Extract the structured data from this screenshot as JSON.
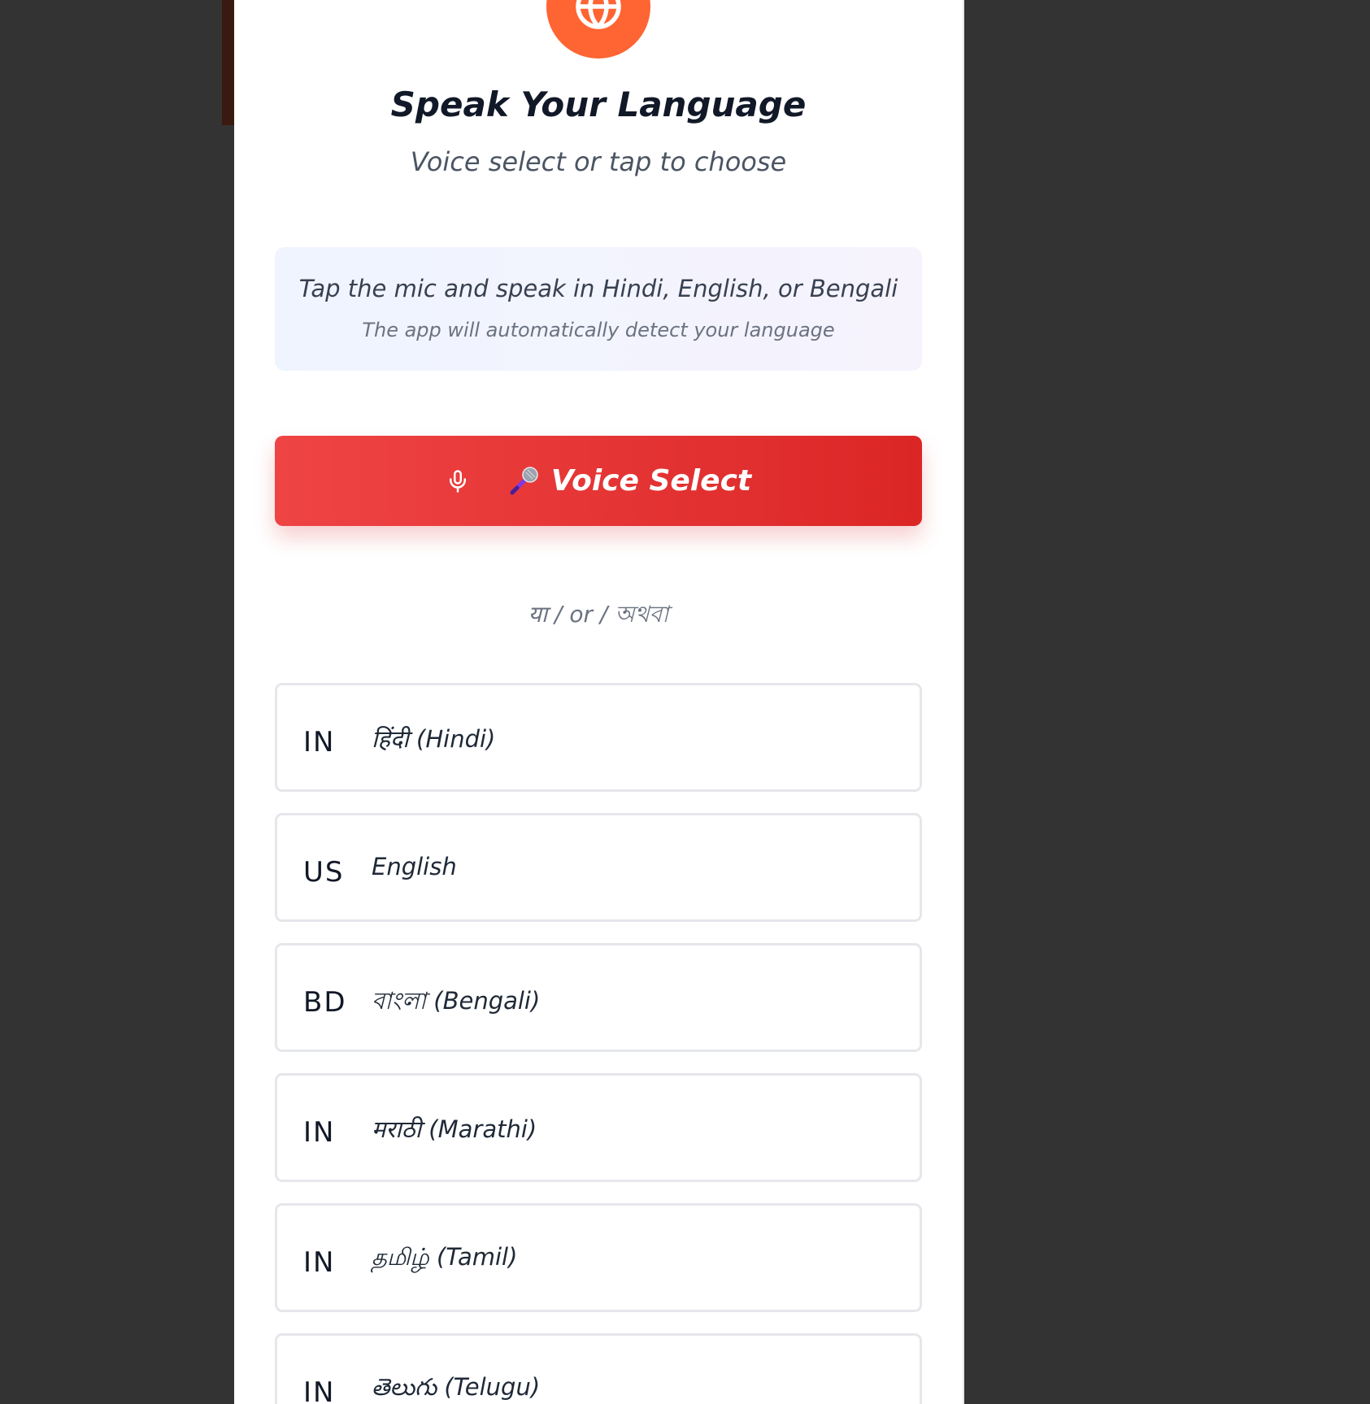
{
  "colors": {
    "accent_orange": "#ff6433",
    "voice_button_red": "#dc2626",
    "backdrop": "#333333",
    "panel": "#ffffff"
  },
  "header": {
    "icon": "globe-icon",
    "title": "Speak Your Language",
    "subtitle": "Voice select or tap to choose"
  },
  "hint": {
    "main": "Tap the mic and speak in Hindi, English, or Bengali",
    "sub": "The app will automatically detect your language"
  },
  "voice_button": {
    "icon": "microphone-icon",
    "emoji": "🎤",
    "label": "Voice Select"
  },
  "divider": {
    "text": "या / or / অথবা"
  },
  "languages": [
    {
      "code": "IN",
      "name": "हिंदी (Hindi)"
    },
    {
      "code": "US",
      "name": "English"
    },
    {
      "code": "BD",
      "name": "বাংলা (Bengali)"
    },
    {
      "code": "IN",
      "name": "मराठी (Marathi)"
    },
    {
      "code": "IN",
      "name": "தமிழ் (Tamil)"
    },
    {
      "code": "IN",
      "name": "తెలుగు (Telugu)"
    }
  ]
}
